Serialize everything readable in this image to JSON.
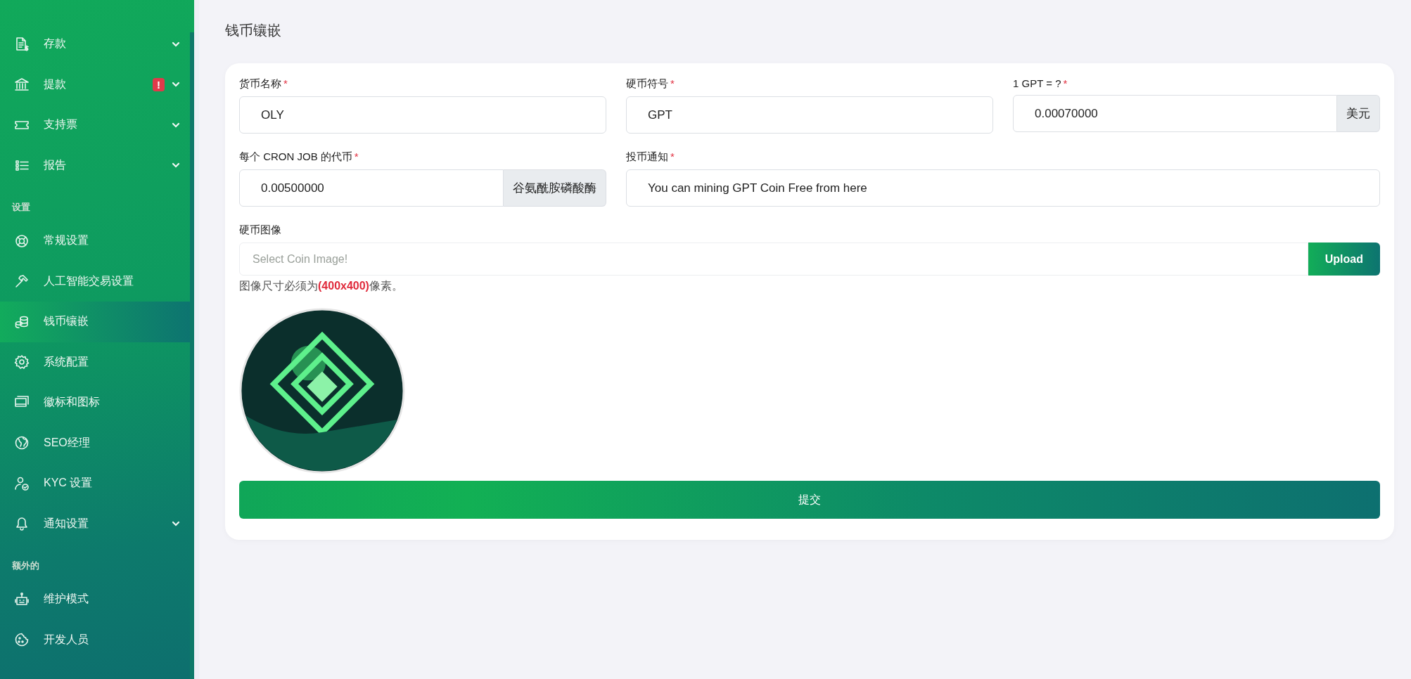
{
  "sidebar": {
    "groups": [
      {
        "items": [
          {
            "label": "存款",
            "selected": false,
            "expandable": true
          },
          {
            "label": "提款",
            "selected": false,
            "expandable": true,
            "badge": "!"
          },
          {
            "label": "支持票",
            "selected": false,
            "expandable": true
          },
          {
            "label": "报告",
            "selected": false,
            "expandable": true
          }
        ]
      },
      {
        "heading": "设置",
        "items": [
          {
            "label": "常规设置",
            "selected": false,
            "expandable": false
          },
          {
            "label": "人工智能交易设置",
            "selected": false,
            "expandable": false
          },
          {
            "label": "钱币镶嵌",
            "selected": true,
            "expandable": false
          },
          {
            "label": "系统配置",
            "selected": false,
            "expandable": false
          },
          {
            "label": "徽标和图标",
            "selected": false,
            "expandable": false
          },
          {
            "label": "SEO经理",
            "selected": false,
            "expandable": false
          },
          {
            "label": "KYC 设置",
            "selected": false,
            "expandable": false
          },
          {
            "label": "通知设置",
            "selected": false,
            "expandable": true
          }
        ]
      },
      {
        "heading": "额外的",
        "items": [
          {
            "label": "维护模式",
            "selected": false,
            "expandable": false
          },
          {
            "label": "开发人员",
            "selected": false,
            "expandable": false
          }
        ]
      }
    ]
  },
  "page_title": "钱币镶嵌",
  "form": {
    "rows": [
      [
        {
          "kind": "text",
          "label": "货币名称",
          "required_mark": "*",
          "value": "OLY"
        },
        {
          "kind": "text",
          "label": "硬币符号",
          "required_mark": "*",
          "value": "GPT"
        },
        {
          "kind": "addon",
          "label": "1 GPT = ?",
          "required_mark": "*",
          "value": "0.00070000",
          "addon": "美元"
        }
      ],
      [
        {
          "kind": "addon",
          "label": "每个 CRON JOB 的代币",
          "required_mark": "*",
          "value": "0.00500000",
          "addon": "谷氨酰胺磷酸酶"
        },
        {
          "kind": "text",
          "label": "投币通知",
          "required_mark": "*",
          "value": "You can mining GPT Coin Free from here"
        }
      ],
      [
        {
          "kind": "file",
          "label": "硬币图像",
          "placeholder": "Select Coin Image!",
          "button": "Upload",
          "hint": "图像尺寸必须为**(400x400)**像素。"
        }
      ]
    ],
    "submit": "提交"
  }
}
